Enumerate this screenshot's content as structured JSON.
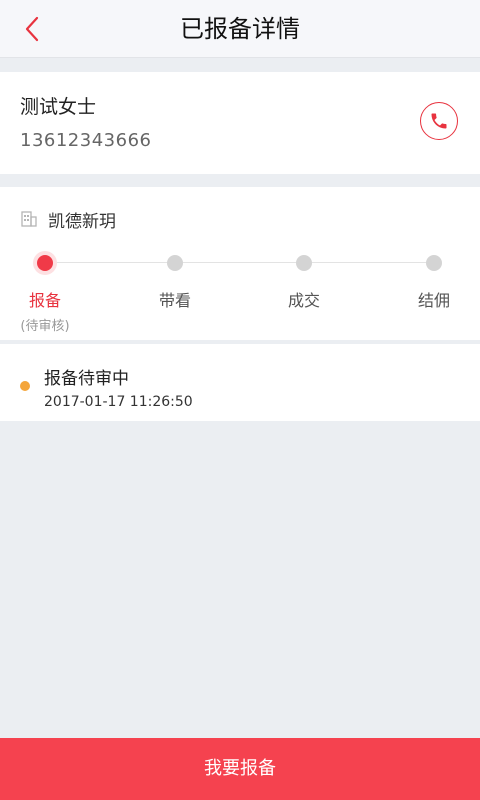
{
  "header": {
    "title": "已报备详情",
    "back_icon": "chevron-left-icon"
  },
  "customer": {
    "name": "测试女士",
    "phone": "13612343666",
    "call_icon": "phone-icon"
  },
  "project": {
    "icon": "building-icon",
    "name": "凯德新玥",
    "steps": [
      {
        "label": "报备",
        "sub": "(待审核)",
        "active": true
      },
      {
        "label": "带看",
        "sub": "",
        "active": false
      },
      {
        "label": "成交",
        "sub": "",
        "active": false
      },
      {
        "label": "结佣",
        "sub": "",
        "active": false
      }
    ]
  },
  "status": {
    "title": "报备待审中",
    "time": "2017-01-17 11:26:50"
  },
  "footer": {
    "submit_label": "我要报备"
  },
  "colors": {
    "accent": "#f5424f",
    "pending": "#f4a53a"
  }
}
